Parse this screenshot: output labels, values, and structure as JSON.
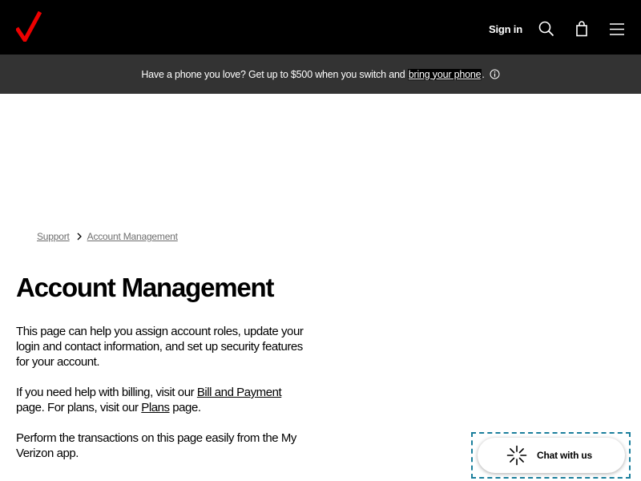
{
  "header": {
    "brand": "Verizon",
    "sign_in_label": "Sign in",
    "icons": [
      "search-icon",
      "cart-icon",
      "menu-icon"
    ]
  },
  "promo": {
    "text": "Have a phone you love? Get up to $500 when you switch and ",
    "link_text": "bring your phone",
    "suffix": "."
  },
  "breadcrumb": {
    "items": [
      "Support",
      "Account Management"
    ]
  },
  "main": {
    "title": "Account Management",
    "paragraph1": "This page can help you assign account roles, update your login and contact information, and set up security features for your account.",
    "paragraph2": {
      "part1": "If you need help with billing, visit our ",
      "link1": "Bill and Payment",
      "part2": " page. For plans, visit our ",
      "link2": "Plans",
      "part3": " page."
    },
    "paragraph3": "Perform the transactions on this page easily from the My Verizon app."
  },
  "chat": {
    "label": "Chat with us"
  },
  "colors": {
    "brand_red": "#ee0000",
    "header_bg": "#000000",
    "promo_bg": "#333333",
    "focus_outline": "#1b7f9c"
  }
}
